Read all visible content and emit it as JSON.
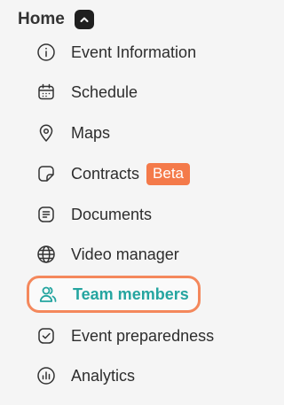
{
  "section": {
    "title": "Home",
    "toggle_icon": "chevron-up-icon"
  },
  "nav": {
    "items": [
      {
        "label": "Event Information",
        "icon": "info-circle-icon"
      },
      {
        "label": "Schedule",
        "icon": "calendar-icon"
      },
      {
        "label": "Maps",
        "icon": "map-pin-icon"
      },
      {
        "label": "Contracts",
        "icon": "sticky-note-icon",
        "badge": "Beta"
      },
      {
        "label": "Documents",
        "icon": "document-lines-icon"
      },
      {
        "label": "Video manager",
        "icon": "globe-icon"
      },
      {
        "label": "Team members",
        "icon": "team-members-icon",
        "active": true
      },
      {
        "label": "Event preparedness",
        "icon": "check-square-icon"
      },
      {
        "label": "Analytics",
        "icon": "bar-chart-icon"
      }
    ]
  },
  "colors": {
    "background": "#f5f5f5",
    "text": "#2d2d2d",
    "active_text": "#25a5a0",
    "active_border": "#f4885c",
    "badge_bg": "#f47a4a"
  }
}
